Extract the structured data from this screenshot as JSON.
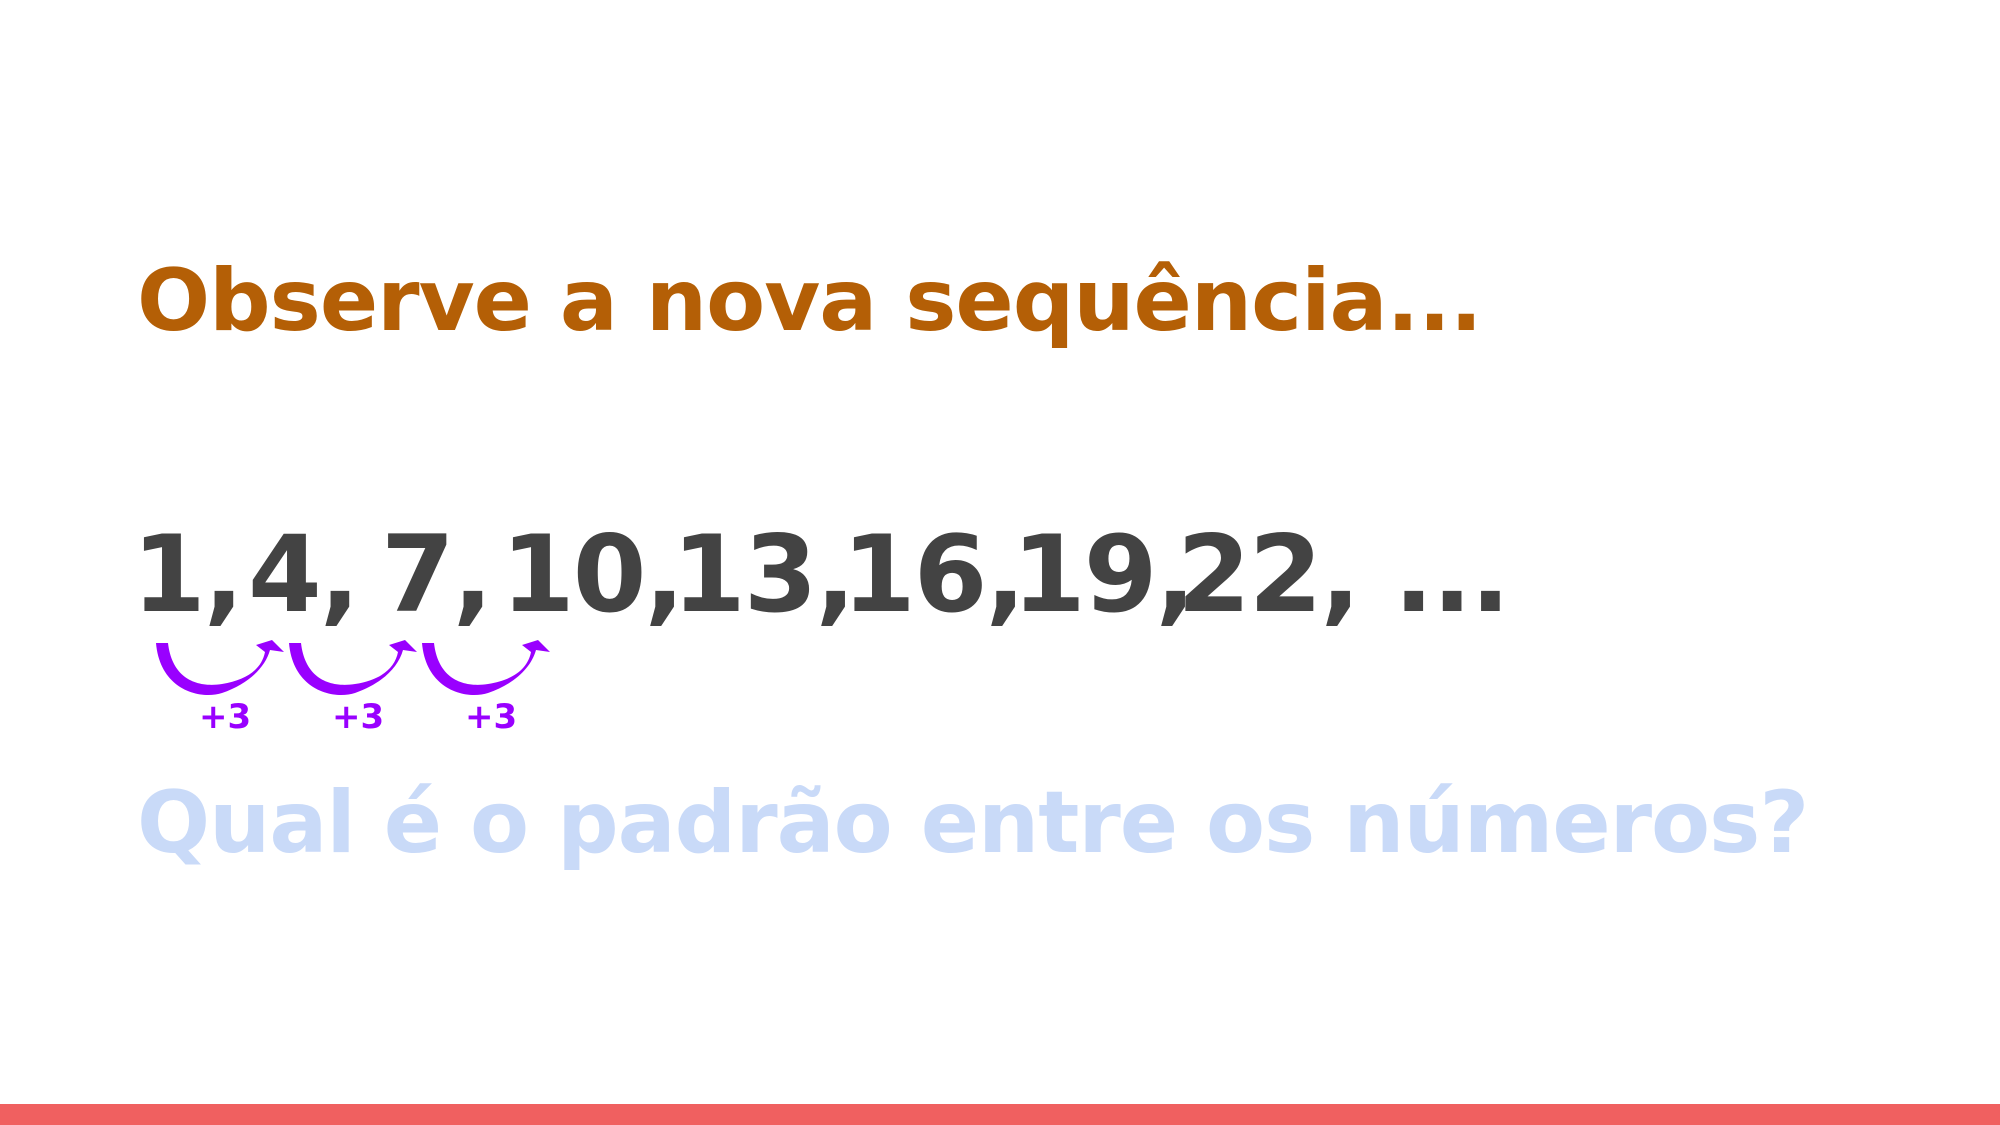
{
  "slide": {
    "title": "Observe a nova sequência...",
    "question": "Qual é o padrão entre os números?",
    "colors": {
      "title": "#b45f06",
      "sequence": "#434343",
      "arrow": "#9900ff",
      "question": "#c9daf8",
      "bottom_bar": "#f06060"
    }
  },
  "sequence": {
    "terms": [
      "1,",
      "4,",
      "7,",
      "10,",
      "13,",
      "16,",
      "19,",
      "22, ..."
    ]
  },
  "steps": {
    "labels": [
      "+3",
      "+3",
      "+3"
    ]
  }
}
